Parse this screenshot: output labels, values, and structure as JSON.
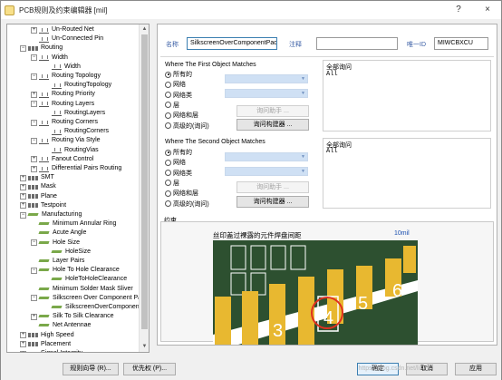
{
  "window": {
    "title": "PCB规则及约束编辑器 [mil]",
    "help_glyph": "?",
    "close_glyph": "×"
  },
  "tree": {
    "expand_glyph": "+",
    "collapse_glyph": "−",
    "items": [
      {
        "label": "Un-Routed Net",
        "level": 2,
        "icon": "rule-icon",
        "expander": "+"
      },
      {
        "label": "Un-Connected Pin",
        "level": 2,
        "icon": "rule-icon",
        "expander": ""
      },
      {
        "label": "Routing",
        "level": 1,
        "icon": "category-icon",
        "expander": "−"
      },
      {
        "label": "Width",
        "level": 2,
        "icon": "rule-icon",
        "expander": "−"
      },
      {
        "label": "Width",
        "level": 3,
        "icon": "rule-icon",
        "expander": ""
      },
      {
        "label": "Routing Topology",
        "level": 2,
        "icon": "rule-icon",
        "expander": "−"
      },
      {
        "label": "RoutingTopology",
        "level": 3,
        "icon": "rule-icon",
        "expander": ""
      },
      {
        "label": "Routing Priority",
        "level": 2,
        "icon": "rule-icon",
        "expander": "+"
      },
      {
        "label": "Routing Layers",
        "level": 2,
        "icon": "rule-icon",
        "expander": "−"
      },
      {
        "label": "RoutingLayers",
        "level": 3,
        "icon": "rule-icon",
        "expander": ""
      },
      {
        "label": "Routing Corners",
        "level": 2,
        "icon": "rule-icon",
        "expander": "−"
      },
      {
        "label": "RoutingCorners",
        "level": 3,
        "icon": "rule-icon",
        "expander": ""
      },
      {
        "label": "Routing Via Style",
        "level": 2,
        "icon": "rule-icon",
        "expander": "−"
      },
      {
        "label": "RoutingVias",
        "level": 3,
        "icon": "rule-icon",
        "expander": ""
      },
      {
        "label": "Fanout Control",
        "level": 2,
        "icon": "rule-icon",
        "expander": "+"
      },
      {
        "label": "Differential Pairs Routing",
        "level": 2,
        "icon": "rule-icon",
        "expander": "+"
      },
      {
        "label": "SMT",
        "level": 1,
        "icon": "category-icon",
        "expander": "+"
      },
      {
        "label": "Mask",
        "level": 1,
        "icon": "category-icon",
        "expander": "+"
      },
      {
        "label": "Plane",
        "level": 1,
        "icon": "category-icon",
        "expander": "+"
      },
      {
        "label": "Testpoint",
        "level": 1,
        "icon": "category-icon",
        "expander": "+"
      },
      {
        "label": "Manufacturing",
        "level": 1,
        "icon": "manufacturing-icon",
        "expander": "−"
      },
      {
        "label": "Minimum Annular Ring",
        "level": 2,
        "icon": "manufacturing-icon",
        "expander": ""
      },
      {
        "label": "Acute Angle",
        "level": 2,
        "icon": "manufacturing-icon",
        "expander": ""
      },
      {
        "label": "Hole Size",
        "level": 2,
        "icon": "manufacturing-icon",
        "expander": "−"
      },
      {
        "label": "HoleSize",
        "level": 3,
        "icon": "manufacturing-icon",
        "expander": ""
      },
      {
        "label": "Layer Pairs",
        "level": 2,
        "icon": "manufacturing-icon",
        "expander": ""
      },
      {
        "label": "Hole To Hole Clearance",
        "level": 2,
        "icon": "manufacturing-icon",
        "expander": "−"
      },
      {
        "label": "HoleToHoleClearance",
        "level": 3,
        "icon": "manufacturing-icon",
        "expander": ""
      },
      {
        "label": "Minimum Solder Mask Sliver",
        "level": 2,
        "icon": "manufacturing-icon",
        "expander": ""
      },
      {
        "label": "Silkscreen Over Component Pads",
        "level": 2,
        "icon": "manufacturing-icon",
        "expander": "−"
      },
      {
        "label": "SilkscreenOverComponentPad",
        "level": 3,
        "icon": "manufacturing-icon",
        "expander": ""
      },
      {
        "label": "Silk To Silk Clearance",
        "level": 2,
        "icon": "manufacturing-icon",
        "expander": "+"
      },
      {
        "label": "Net Antennae",
        "level": 2,
        "icon": "manufacturing-icon",
        "expander": ""
      },
      {
        "label": "High Speed",
        "level": 1,
        "icon": "category-icon",
        "expander": "+"
      },
      {
        "label": "Placement",
        "level": 1,
        "icon": "category-icon",
        "expander": "+"
      },
      {
        "label": "Signal Integrity",
        "level": 1,
        "icon": "category-icon",
        "expander": "+"
      }
    ],
    "scroll_up_glyph": "▲",
    "scroll_down_glyph": "▼"
  },
  "rule": {
    "name_label": "名称",
    "name_value": "SilkscreenOverComponentPads",
    "comment_label": "注释",
    "comment_value": "",
    "id_label": "唯一ID",
    "id_value": "MIWCBXCU"
  },
  "first_match": {
    "title": "Where The First Object Matches",
    "options": [
      "所有的",
      "网络",
      "网络类",
      "层",
      "网络和层",
      "高级的(询问)"
    ],
    "selected": "所有的",
    "query_helper_label": "询问助手 ...",
    "query_builder_label": "询问构建器 ...",
    "full_query_label": "全部询问",
    "full_query_value": "All"
  },
  "second_match": {
    "title": "Where The Second Object Matches",
    "options": [
      "所有的",
      "网络",
      "网络类",
      "层",
      "网络和层",
      "高级的(询问)"
    ],
    "selected": "所有的",
    "query_helper_label": "询问助手 ...",
    "query_builder_label": "询问构建器 ...",
    "full_query_label": "全部询问",
    "full_query_value": "All"
  },
  "constraint": {
    "section_label": "约束",
    "description": "丝印盖过裸露的元件焊盘间距",
    "value_label": "10mil",
    "pad_numbers": [
      "3",
      "4",
      "5",
      "6"
    ]
  },
  "footer": {
    "wizard_button": "规则向导 (R)...",
    "priority_button": "优先权 (P)...",
    "ok_button": "确定",
    "cancel_button": "取消",
    "apply_button": "应用",
    "watermark": "https://blog.csdn.net/li..."
  },
  "colors": {
    "pcb_background": "#2d5030",
    "pad": "#e8b830",
    "silkscreen": "#ffffff",
    "highlight_circle": "#e03020",
    "highlight_box": "#ffffff",
    "combo_fill": "#cfe0f4",
    "focus_border": "#3c7fb1"
  }
}
